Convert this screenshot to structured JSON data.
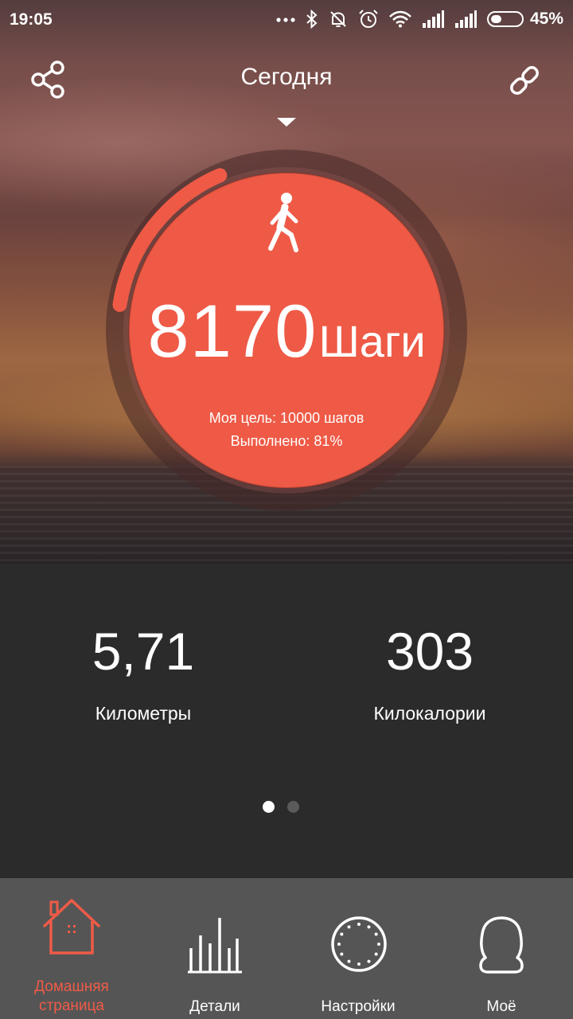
{
  "status_bar": {
    "time": "19:05",
    "battery": "45%",
    "battery_level": 0.45,
    "icons": [
      "more-dots-icon",
      "bluetooth-icon",
      "notifications-off-icon",
      "alarm-icon",
      "wifi-icon",
      "signal-icon",
      "signal-icon",
      "battery-icon"
    ]
  },
  "header": {
    "title": "Сегодня",
    "share_icon": "share-icon",
    "link_icon": "link-icon",
    "dropdown_icon": "caret-down-icon"
  },
  "steps": {
    "value": "8170",
    "unit": "Шаги",
    "goal_text": "Моя цель: 10000 шагов",
    "done_text": "Выполнено: 81%",
    "progress": 0.81,
    "icon": "walking-person-icon"
  },
  "stats": [
    {
      "value": "5,71",
      "label": "Километры"
    },
    {
      "value": "303",
      "label": "Килокалории"
    }
  ],
  "pager": {
    "pages": 2,
    "current": 1
  },
  "tabs": [
    {
      "label_line1": "Домашняя",
      "label_line2": "страница",
      "icon": "home-icon",
      "active": true
    },
    {
      "label": "Детали",
      "icon": "bar-chart-icon",
      "active": false
    },
    {
      "label": "Настройки",
      "icon": "watch-dial-icon",
      "active": false
    },
    {
      "label": "Моё",
      "icon": "profile-icon",
      "active": false
    }
  ],
  "colors": {
    "accent": "#ef5b47",
    "circle": "#ee5a46",
    "panel": "#2b2b2b",
    "tabbar": "#555555"
  }
}
